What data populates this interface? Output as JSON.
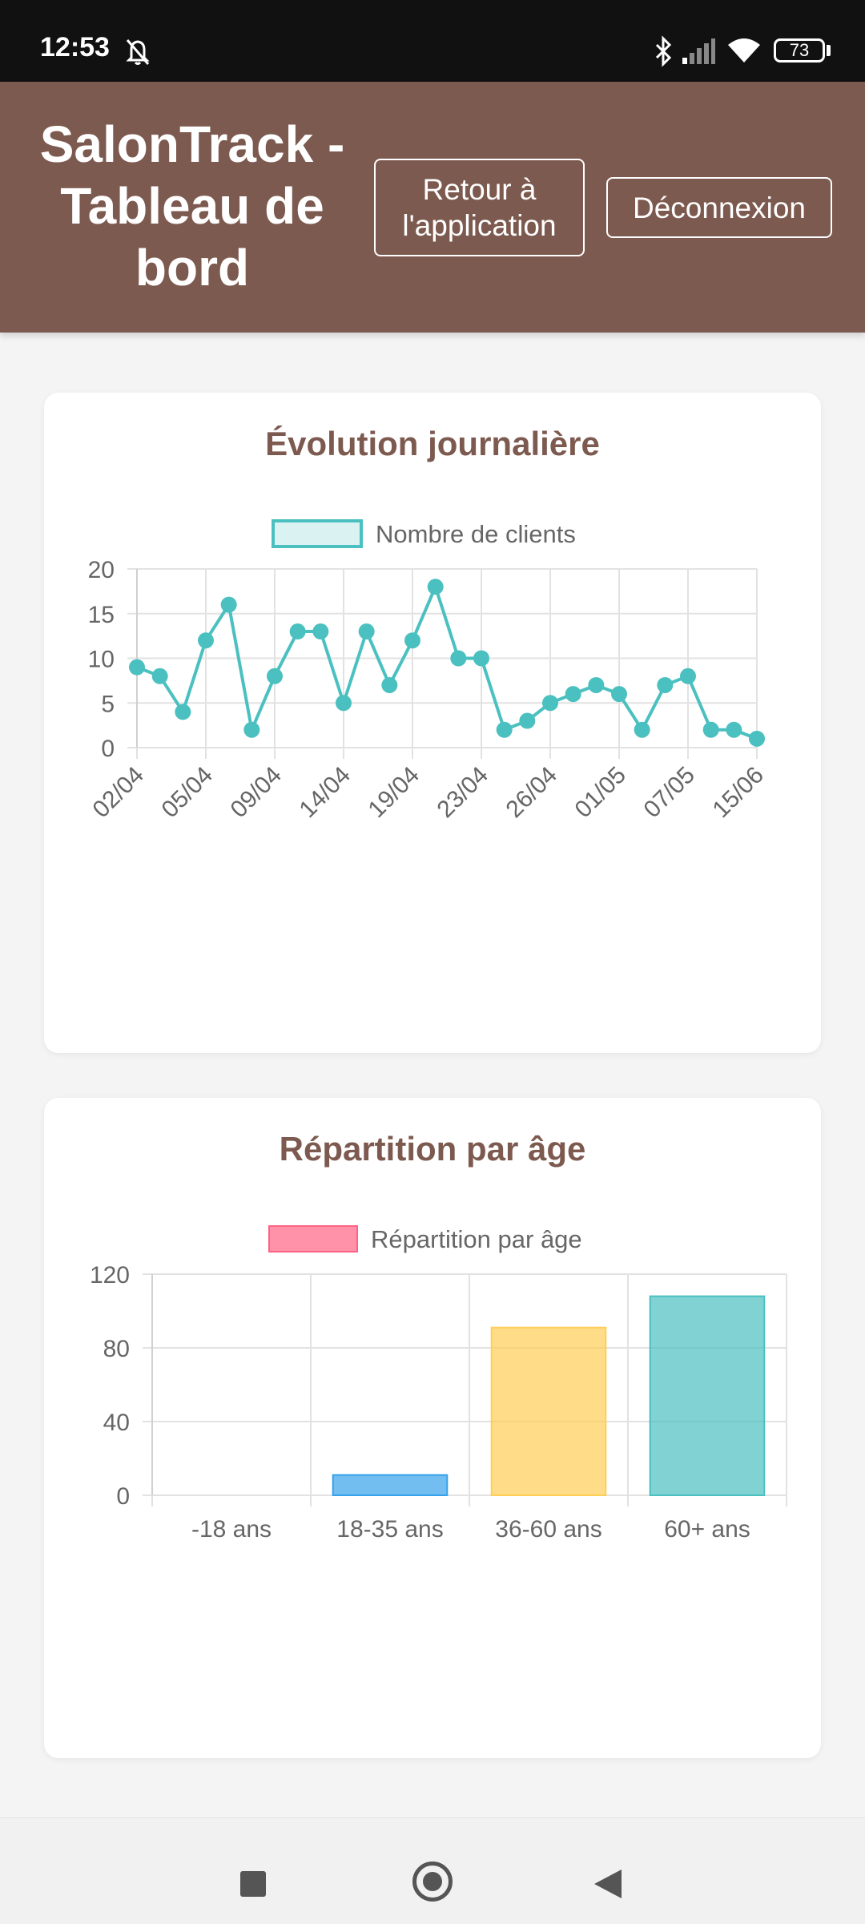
{
  "status_bar": {
    "time": "12:53",
    "battery": "73",
    "icons": [
      "mute-bell-icon",
      "bluetooth-icon",
      "signal-icon",
      "wifi-icon",
      "battery-icon"
    ]
  },
  "header": {
    "title": "SalonTrack - Tableau de bord",
    "title_lines": [
      "SalonTrack -",
      "Tableau de",
      "bord"
    ],
    "back_button": "Retour à l'application",
    "back_button_lines": [
      "Retour à",
      "l'application"
    ],
    "logout_button": "Déconnexion"
  },
  "colors": {
    "brand": "#7d5a4f",
    "line_series": "#4bc0c0",
    "legend_pink": "#ff6384"
  },
  "chart_data": [
    {
      "type": "line",
      "title": "Évolution journalière",
      "legend": {
        "position": "top",
        "entries": [
          "Nombre de clients"
        ]
      },
      "x_tick_labels": [
        "02/04",
        "05/04",
        "09/04",
        "14/04",
        "19/04",
        "23/04",
        "26/04",
        "01/05",
        "07/05",
        "15/06"
      ],
      "series": [
        {
          "name": "Nombre de clients",
          "color": "#4bc0c0",
          "values": [
            9,
            8,
            4,
            12,
            16,
            2,
            8,
            13,
            13,
            5,
            13,
            7,
            12,
            18,
            10,
            10,
            2,
            3,
            5,
            6,
            7,
            6,
            2,
            7,
            8,
            2,
            2,
            1
          ]
        }
      ],
      "y_ticks": [
        "20",
        "15",
        "10",
        "5",
        "0"
      ],
      "ylim": [
        0,
        20
      ],
      "grid": true
    },
    {
      "type": "bar",
      "title": "Répartition par âge",
      "legend": {
        "position": "top",
        "entries": [
          "Répartition par âge"
        ]
      },
      "categories": [
        "-18 ans",
        "18-35 ans",
        "36-60 ans",
        "60+ ans"
      ],
      "series": [
        {
          "name": "Répartition par âge",
          "values": [
            0,
            11,
            91,
            108
          ],
          "colors": [
            "#ff6384",
            "#36a2eb",
            "#ffce56",
            "#4bc0c0"
          ]
        }
      ],
      "y_ticks": [
        "120",
        "80",
        "40",
        "0"
      ],
      "ylim": [
        0,
        120
      ],
      "grid": true
    }
  ]
}
